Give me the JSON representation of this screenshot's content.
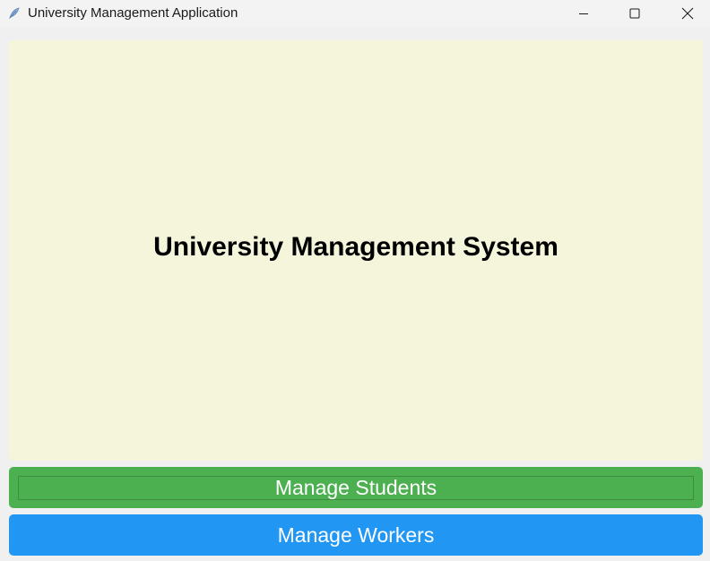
{
  "window": {
    "title": "University Management Application",
    "app_icon": "feather-icon",
    "controls": {
      "minimize_icon": "minimize-icon",
      "maximize_icon": "maximize-icon",
      "close_icon": "close-icon"
    }
  },
  "main": {
    "heading": "University Management System",
    "panel_color": "#f5f5dc"
  },
  "actions": {
    "manage_students_label": "Manage Students",
    "manage_students_color": "#4caf50",
    "manage_workers_label": "Manage Workers",
    "manage_workers_color": "#2196f3"
  }
}
